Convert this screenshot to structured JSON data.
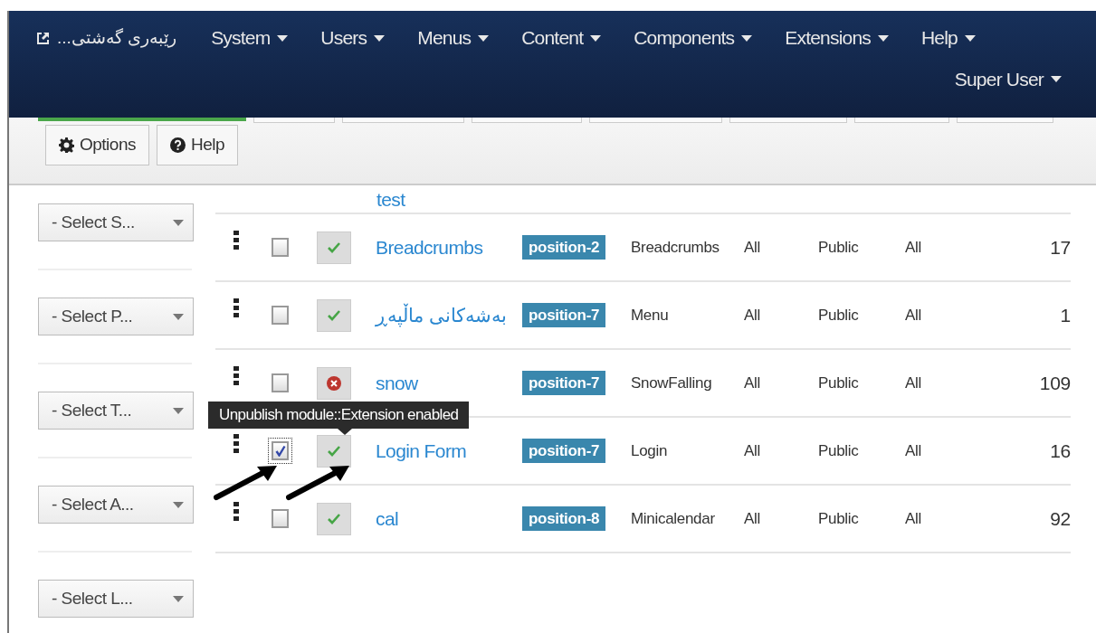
{
  "navbar": {
    "brand": "رێبەری گەشتی...",
    "menus": [
      {
        "label": "System"
      },
      {
        "label": "Users"
      },
      {
        "label": "Menus"
      },
      {
        "label": "Content"
      },
      {
        "label": "Components"
      },
      {
        "label": "Extensions"
      },
      {
        "label": "Help"
      }
    ],
    "user_menu": "Super User"
  },
  "toolbar": {
    "buttons": [
      {
        "label": "Options"
      },
      {
        "label": "Help"
      }
    ]
  },
  "filters": [
    {
      "placeholder": "- Select S..."
    },
    {
      "placeholder": "- Select P..."
    },
    {
      "placeholder": "- Select T..."
    },
    {
      "placeholder": "- Select A..."
    },
    {
      "placeholder": "- Select L..."
    }
  ],
  "table": {
    "partial_row": {
      "title": "test"
    },
    "rows": [
      {
        "checked": false,
        "published": true,
        "title": "Breadcrumbs",
        "position": "position-2",
        "type": "Breadcrumbs",
        "pages": "All",
        "access": "Public",
        "language": "All",
        "id": "17"
      },
      {
        "checked": false,
        "published": true,
        "title": "بەشەکانی ماڵپەڕ",
        "position": "position-7",
        "type": "Menu",
        "pages": "All",
        "access": "Public",
        "language": "All",
        "id": "1"
      },
      {
        "checked": false,
        "published": false,
        "title": "snow",
        "position": "position-7",
        "type": "SnowFalling",
        "pages": "All",
        "access": "Public",
        "language": "All",
        "id": "109"
      },
      {
        "checked": true,
        "published": true,
        "title": "Login Form",
        "position": "position-7",
        "type": "Login",
        "pages": "All",
        "access": "Public",
        "language": "All",
        "id": "16"
      },
      {
        "checked": false,
        "published": true,
        "title": "cal",
        "position": "position-8",
        "type": "Minicalendar",
        "pages": "All",
        "access": "Public",
        "language": "All",
        "id": "92"
      }
    ]
  },
  "tooltip": {
    "text": "Unpublish module::Extension enabled"
  }
}
